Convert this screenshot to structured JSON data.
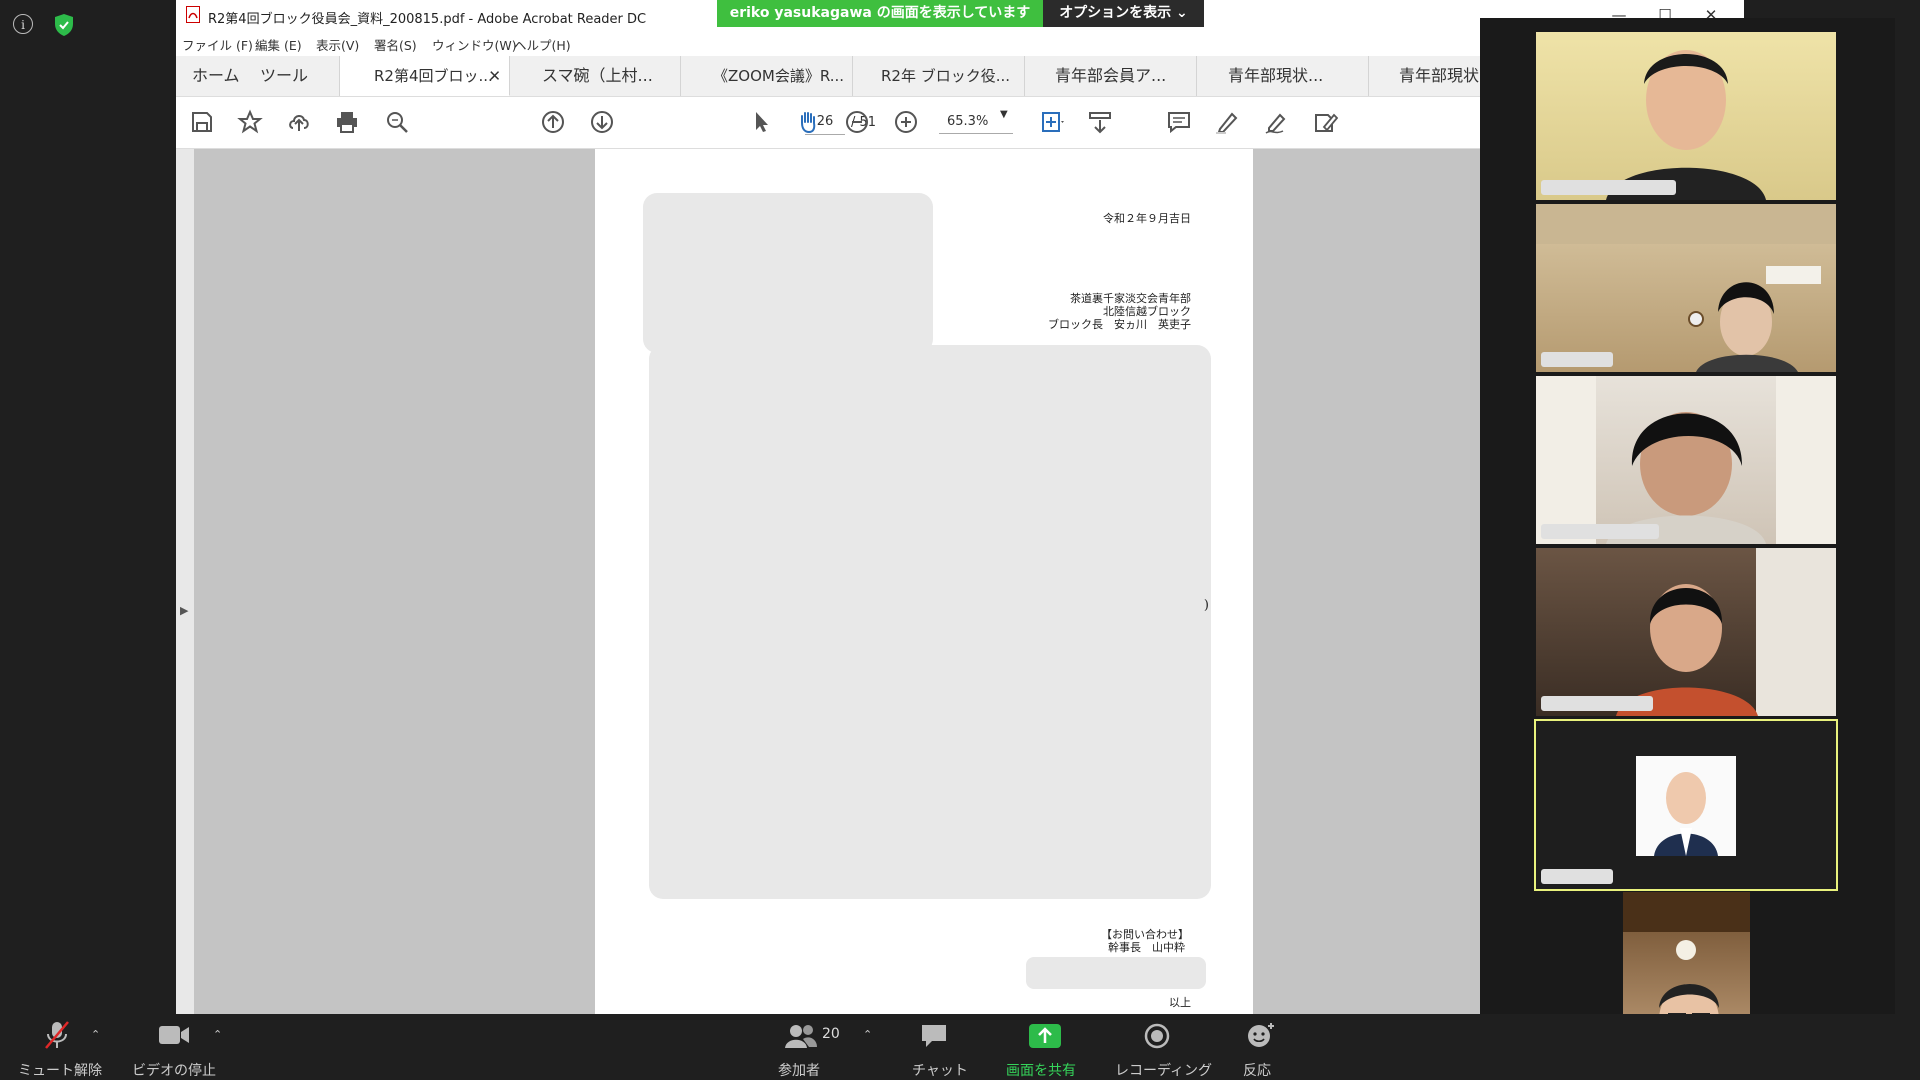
{
  "zoom": {
    "share_banner": "eriko  yasukagawa の画面を表示しています",
    "options_label": "オプションを表示",
    "participants_count": "20"
  },
  "acrobat": {
    "window_title": "R2第4回ブロック役員会_資料_200815.pdf - Adobe Acrobat Reader DC",
    "menu": [
      "ファイル (F)",
      "編集 (E)",
      "表示(V)",
      "署名(S)",
      "ウィンドウ(W)",
      "ヘルプ(H)"
    ],
    "tabs": [
      "ホーム",
      "ツール",
      "R2第4回ブロッ...",
      "スマ碗（上村...",
      "《ZOOM会議》R...",
      "R2年 ブロック役...",
      "青年部会員ア...",
      "青年部現状...",
      "青年部現状"
    ],
    "page_current": "26",
    "page_total": "/ 51",
    "zoom_value": "65.3%"
  },
  "pdf": {
    "date": "令和２年９月吉日",
    "sender_line1": "茶道裏千家淡交会青年部",
    "sender_line2": "北陸信越ブロック",
    "sender_line3": "ブロック長　安ヵ川　英吏子",
    "contact_heading": "【お問い合わせ】",
    "contact_person": "幹事長　山中粋",
    "closing": "以上",
    "stray_mark": ")"
  },
  "controls": {
    "mute": "ミュート解除",
    "video": "ビデオの停止",
    "participants": "参加者",
    "chat": "チャット",
    "share": "画面を共有",
    "record": "レコーディング",
    "reactions": "反応"
  },
  "colors": {
    "zoom_green": "#3fbf3f",
    "active_speaker_border": "#e9f27d",
    "share_icon_green": "#2dbb4a"
  }
}
